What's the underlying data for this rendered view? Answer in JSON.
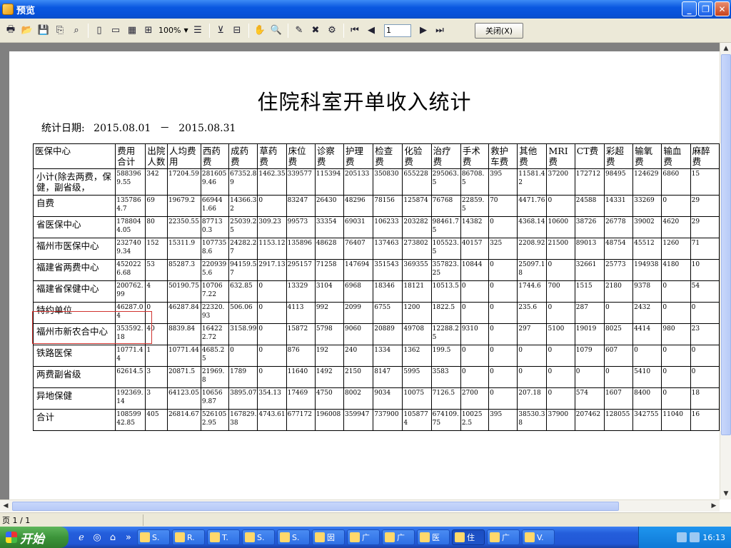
{
  "window": {
    "title": "预览",
    "controls": [
      "_",
      "❐",
      "✕"
    ]
  },
  "toolbar": {
    "zoom": "100%",
    "page_input": "1",
    "close_label": "关闭(X)",
    "icons": [
      "print-icon",
      "open-icon",
      "save-icon",
      "export-icon",
      "find-icon",
      "single-page-icon",
      "two-page-icon",
      "four-page-icon",
      "multi-page-icon",
      "outline-icon",
      "thumbnail-icon",
      "tree-icon",
      "hand-icon",
      "zoom-icon",
      "edit-icon",
      "delete-icon",
      "design-icon",
      "first-page-icon",
      "prev-page-icon",
      "next-page-icon",
      "last-page-icon"
    ]
  },
  "report": {
    "title": "住院科室开单收入统计",
    "date_label": "统计日期:",
    "date_from": "2015.08.01",
    "date_sep": "－",
    "date_to": "2015.08.31",
    "headers": [
      "医保中心",
      "费用合计",
      "出院人数",
      "人均费用",
      "西药费",
      "成药费",
      "草药费",
      "床位费",
      "诊察费",
      "护理费",
      "检查费",
      "化验费",
      "治疗费",
      "手术费",
      "救护车费",
      "其他费",
      "MRI费",
      "CT费",
      "彩超费",
      "输氧费",
      "输血费",
      "麻醉费"
    ],
    "rows": [
      [
        "小计(除去两费，保健，副省级，",
        "5883969.55",
        "342",
        "17204.59",
        "2816059.46",
        "67352.89",
        "1462.35",
        "339577",
        "115394",
        "205133",
        "350830",
        "655228",
        "295063.5",
        "86708.5",
        "395",
        "11581.42",
        "37200",
        "172712",
        "98495",
        "124629",
        "6860",
        "15"
      ],
      [
        "自费",
        "1357864.7",
        "69",
        "19679.2",
        "669441.66",
        "14366.32",
        "0",
        "83247",
        "26430",
        "48296",
        "78156",
        "125874",
        "76768",
        "22859.5",
        "70",
        "4471.76",
        "0",
        "24588",
        "14331",
        "33269",
        "0",
        "29"
      ],
      [
        "省医保中心",
        "1788044.05",
        "80",
        "22350.55",
        "877130.3",
        "25039.25",
        "309.23",
        "99573",
        "33354",
        "69031",
        "106233",
        "203282",
        "98461.75",
        "14382",
        "0",
        "4368.14",
        "10600",
        "38726",
        "26778",
        "39002",
        "4620",
        "29"
      ],
      [
        "福州市医保中心",
        "2327409.34",
        "152",
        "15311.9",
        "1077358.6",
        "24282.27",
        "1153.12",
        "135896",
        "48628",
        "76407",
        "137463",
        "273802",
        "105523.5",
        "40157",
        "325",
        "2208.92",
        "21500",
        "89013",
        "48754",
        "45512",
        "1260",
        "71"
      ],
      [
        "福建省两费中心",
        "4520226.68",
        "53",
        "85287.3",
        "2209395.6",
        "94159.57",
        "2917.13",
        "295157",
        "71258",
        "147694",
        "351543",
        "369355",
        "357823.25",
        "10844",
        "0",
        "25097.18",
        "0",
        "32661",
        "25773",
        "194938",
        "4180",
        "10"
      ],
      [
        "福建省保健中心",
        "200762.99",
        "4",
        "50190.75",
        "107067.22",
        "632.85",
        "0",
        "13329",
        "3104",
        "6968",
        "18346",
        "18121",
        "10513.5",
        "0",
        "0",
        "1744.6",
        "700",
        "1515",
        "2180",
        "9378",
        "0",
        "54"
      ],
      [
        "特约单位",
        "46287.04",
        "0",
        "46287.84",
        "22320.93",
        "506.06",
        "0",
        "4113",
        "992",
        "2099",
        "6755",
        "1200",
        "1822.5",
        "0",
        "0",
        "235.6",
        "0",
        "287",
        "0",
        "2432",
        "0",
        "0"
      ],
      [
        "福州市新农合中心",
        "353592.18",
        "40",
        "8839.84",
        "164222.72",
        "3158.99",
        "0",
        "15872",
        "5798",
        "9060",
        "20889",
        "49708",
        "12288.25",
        "9310",
        "0",
        "297",
        "5100",
        "19019",
        "8025",
        "4414",
        "980",
        "23"
      ],
      [
        "铁路医保",
        "10771.44",
        "1",
        "10771.44",
        "4685.25",
        "0",
        "0",
        "876",
        "192",
        "240",
        "1334",
        "1362",
        "199.5",
        "0",
        "0",
        "0",
        "0",
        "1079",
        "607",
        "0",
        "0",
        "0"
      ],
      [
        "两费副省级",
        "62614.5",
        "3",
        "20871.5",
        "21969.8",
        "1789",
        "0",
        "11640",
        "1492",
        "2150",
        "8147",
        "5995",
        "3583",
        "0",
        "0",
        "0",
        "0",
        "0",
        "0",
        "5410",
        "0",
        "0"
      ],
      [
        "异地保健",
        "192369.14",
        "3",
        "64123.05",
        "106569.87",
        "3895.07",
        "354.13",
        "17469",
        "4750",
        "8002",
        "9034",
        "10075",
        "7126.5",
        "2700",
        "0",
        "207.18",
        "0",
        "574",
        "1607",
        "8400",
        "0",
        "18"
      ],
      [
        "合计",
        "10859942.85",
        "405",
        "26814.67",
        "5261052.95",
        "167829.38",
        "4743.61",
        "677172",
        "196008",
        "359947",
        "737900",
        "1058774",
        "674109.75",
        "100252.5",
        "395",
        "38530.38",
        "37900",
        "207462",
        "128055",
        "342755",
        "11040",
        "16"
      ]
    ]
  },
  "status": {
    "page": "页 1 / 1"
  },
  "taskbar": {
    "start": "开始",
    "tasks": [
      "S.",
      "R.",
      "T.",
      "S.",
      "S.",
      "囡",
      "广",
      "广",
      "医",
      "住",
      "广",
      "V."
    ],
    "clock": "16:13"
  }
}
